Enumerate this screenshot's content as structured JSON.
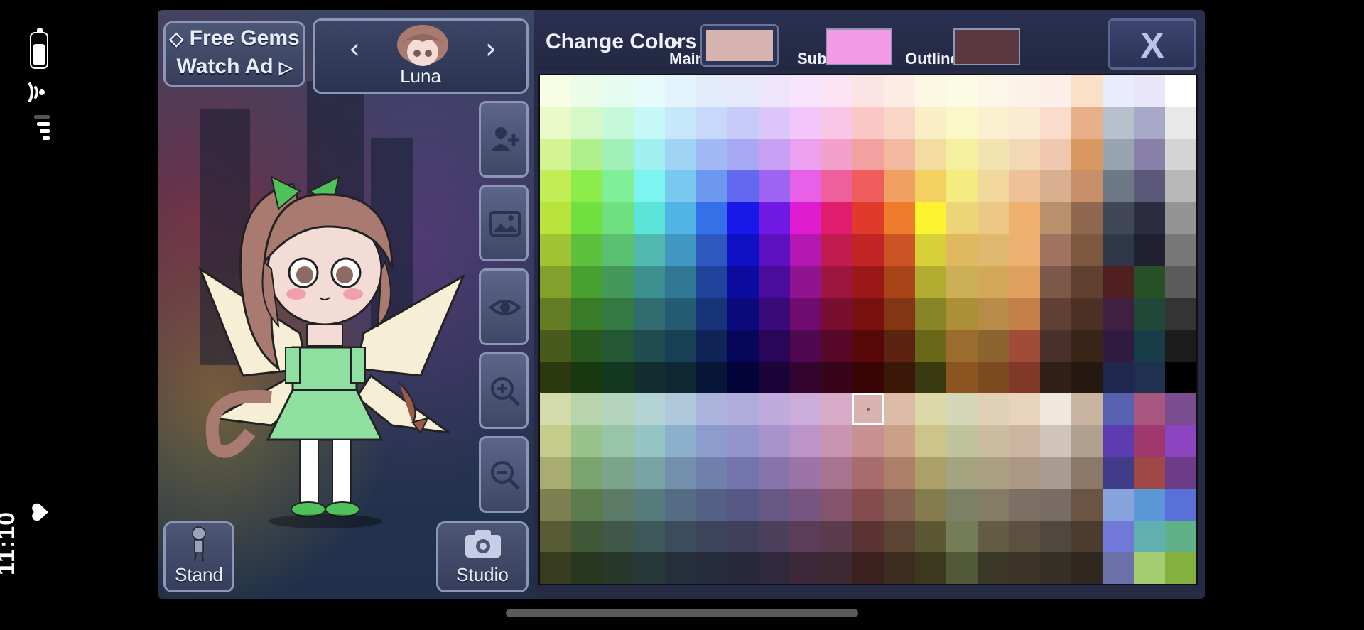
{
  "status": {
    "time": "11:10"
  },
  "header": {
    "free_gems": "Free Gems",
    "watch_ad": "Watch Ad",
    "character_name": "Luna"
  },
  "buttons": {
    "stand": "Stand",
    "studio": "Studio",
    "close": "X"
  },
  "color_panel": {
    "title": "Change Colors",
    "main_label": "Main",
    "sub_label": "Sub",
    "outline_label": "Outline",
    "main_color": "#d8b4b0",
    "sub_color": "#f29be6",
    "outline_color": "#5b3840",
    "selected_cell": [
      10,
      10
    ]
  },
  "palette": [
    [
      "#f8fde6",
      "#ebfde8",
      "#e6fcf0",
      "#e6fcfc",
      "#e4f4fc",
      "#e4ecfc",
      "#e6e8fc",
      "#eee4fc",
      "#f8e4fc",
      "#fce4f4",
      "#fce4e4",
      "#fcece4",
      "#fcf8e4",
      "#fcfce4",
      "#fcf6e8",
      "#fcf2e8",
      "#fceee8",
      "#fbe0c8",
      "#e8ecfc",
      "#e8e6f8",
      "#ffffff"
    ],
    [
      "#eaf9c8",
      "#d4f8c8",
      "#c6f8da",
      "#c6f8f8",
      "#c6e8fa",
      "#c8d8fa",
      "#c8cafa",
      "#dcc6fa",
      "#f2c6fa",
      "#fac6e6",
      "#fac6c6",
      "#fad6c6",
      "#faeec6",
      "#faf8c6",
      "#faf0d0",
      "#faead2",
      "#fadccc",
      "#e8b088",
      "#b8c0cc",
      "#a8a8c8",
      "#e8e8e8"
    ],
    [
      "#d4f494",
      "#b0f08c",
      "#a0f0b8",
      "#a0f0f0",
      "#a0d4f4",
      "#a0b8f4",
      "#a8a8f4",
      "#c8a0f4",
      "#eca0f0",
      "#f2a0cc",
      "#f2a0a0",
      "#f2b8a0",
      "#f2dca0",
      "#f4f0a0",
      "#f2e4b0",
      "#f2d8b4",
      "#f0c8b0",
      "#d89860",
      "#98a4b0",
      "#8880a8",
      "#d4d4d4"
    ],
    [
      "#c0ee54",
      "#8cec4c",
      "#80f098",
      "#7cf4f0",
      "#78c8f0",
      "#6c98f0",
      "#6468f0",
      "#9c64f0",
      "#e860e8",
      "#ee609c",
      "#ee5c5c",
      "#f0a060",
      "#f4d060",
      "#f4ec80",
      "#f2d89c",
      "#f0c098",
      "#d8b090",
      "#c89068",
      "#6c7886",
      "#5c587a",
      "#b8b8b8"
    ],
    [
      "#b8e43c",
      "#70e040",
      "#6ee080",
      "#5ce4d8",
      "#50b4e4",
      "#3470e8",
      "#1818e8",
      "#7018e4",
      "#e01cd0",
      "#e01c6c",
      "#e03a2c",
      "#ee7c2c",
      "#fcf430",
      "#ecd478",
      "#ecc884",
      "#f0b070",
      "#b8906c",
      "#906850",
      "#404858",
      "#2c2c40",
      "#949494"
    ],
    [
      "#a0c434",
      "#5cc03c",
      "#58c070",
      "#50b8b0",
      "#4098c0",
      "#2c58c0",
      "#1010c4",
      "#5c10c0",
      "#b418b0",
      "#c01c50",
      "#c02424",
      "#cc5424",
      "#d8d038",
      "#e0b860",
      "#e0b870",
      "#ecb070",
      "#a07460",
      "#7c5840",
      "#2e3848",
      "#202030",
      "#787878"
    ],
    [
      "#84a02c",
      "#48a030",
      "#44985a",
      "#3c9090",
      "#307894",
      "#20449c",
      "#0c0ca0",
      "#4a0c9c",
      "#901490",
      "#9c1640",
      "#9c1818",
      "#a84418",
      "#b4ac30",
      "#ccb058",
      "#d4a858",
      "#e0a060",
      "#7c5848",
      "#604030",
      "#502020",
      "#285028",
      "#5c5c5c"
    ],
    [
      "#647c24",
      "#387c28",
      "#347844",
      "#306c70",
      "#245c74",
      "#183478",
      "#0a0a7c",
      "#3a0a78",
      "#700c70",
      "#780e30",
      "#781010",
      "#843614",
      "#888428",
      "#ac9038",
      "#b88c48",
      "#c48048",
      "#604034",
      "#4c3024",
      "#402040",
      "#204838",
      "#343434"
    ],
    [
      "#485a1c",
      "#285820",
      "#245834",
      "#204c50",
      "#184054",
      "#102458",
      "#06065a",
      "#2a0658",
      "#500850",
      "#580828",
      "#580808",
      "#5c2410",
      "#6a6818",
      "#9c6c2c",
      "#8c6430",
      "#a04c38",
      "#4a3028",
      "#3a2418",
      "#301c40",
      "#183c48",
      "#1c1c1c"
    ],
    [
      "#2c3810",
      "#183810",
      "#143820",
      "#142e30",
      "#102834",
      "#081638",
      "#04043a",
      "#1c0438",
      "#340430",
      "#380418",
      "#380404",
      "#3a1808",
      "#3a3a10",
      "#8c5420",
      "#7c4c20",
      "#803828",
      "#302018",
      "#241810",
      "#202850",
      "#203050",
      "#000000"
    ],
    [
      "#d4dcac",
      "#b8d4ac",
      "#b4d4c0",
      "#b4d4d4",
      "#b0c8dc",
      "#acb4dc",
      "#b0acdc",
      "#c0acdc",
      "#ccacd8",
      "#d8acc8",
      "#d8b4b0",
      "#dcbca8",
      "#dcd8a8",
      "#d4d8b8",
      "#e0d0b8",
      "#e8d4bc",
      "#f0e8dc",
      "#c8b4a0",
      "#5860b0",
      "#a85880",
      "#7a4c90"
    ],
    [
      "#c4cc8c",
      "#98c48c",
      "#98c4a8",
      "#94c4c4",
      "#8cb0cc",
      "#8c9ccc",
      "#9494cc",
      "#a894cc",
      "#bc94c8",
      "#c894b0",
      "#c89090",
      "#cca088",
      "#ccc488",
      "#c0c49c",
      "#ccbca0",
      "#ccb4a0",
      "#d0c4b8",
      "#b0a090",
      "#5c3cb0",
      "#a03870",
      "#8c44c0"
    ],
    [
      "#a8ac70",
      "#7ca470",
      "#7ca48c",
      "#78a4a4",
      "#7490ac",
      "#7080ac",
      "#7474ac",
      "#8874ac",
      "#9c74a8",
      "#a87490",
      "#a86c6c",
      "#ac8068",
      "#aca068",
      "#a4a480",
      "#aca084",
      "#ac9884",
      "#a89c90",
      "#8c7868",
      "#403c88",
      "#a04848",
      "#6c3c88"
    ],
    [
      "#7c8050",
      "#5c7c50",
      "#5c7c68",
      "#587c7c",
      "#546c84",
      "#546084",
      "#585884",
      "#685884",
      "#785480",
      "#84546c",
      "#844c4c",
      "#846050",
      "#847c4c",
      "#7c8064",
      "#847c64",
      "#7c7064",
      "#786c64",
      "#6c5444",
      "#88a4dc",
      "#5c98d8",
      "#5870d8"
    ],
    [
      "#585c34",
      "#405838",
      "#405848",
      "#3c5858",
      "#3c4c5c",
      "#3c445c",
      "#40405c",
      "#4c405c",
      "#5c3c58",
      "#5c3c4c",
      "#5c3434",
      "#5c4434",
      "#5c5834",
      "#747c58",
      "#645c44",
      "#5c5040",
      "#504840",
      "#4c3c30",
      "#7078d8",
      "#60b0b0",
      "#60b088"
    ],
    [
      "#383c20",
      "#283820",
      "#28382c",
      "#263838",
      "#26303c",
      "#262c3c",
      "#28283c",
      "#30283c",
      "#3c2838",
      "#3c2830",
      "#3c2020",
      "#3c2c20",
      "#3c3820",
      "#505838",
      "#3c3828",
      "#3c3428",
      "#343028",
      "#302820",
      "#6c70a8",
      "#a4cc70",
      "#84b040"
    ]
  ]
}
